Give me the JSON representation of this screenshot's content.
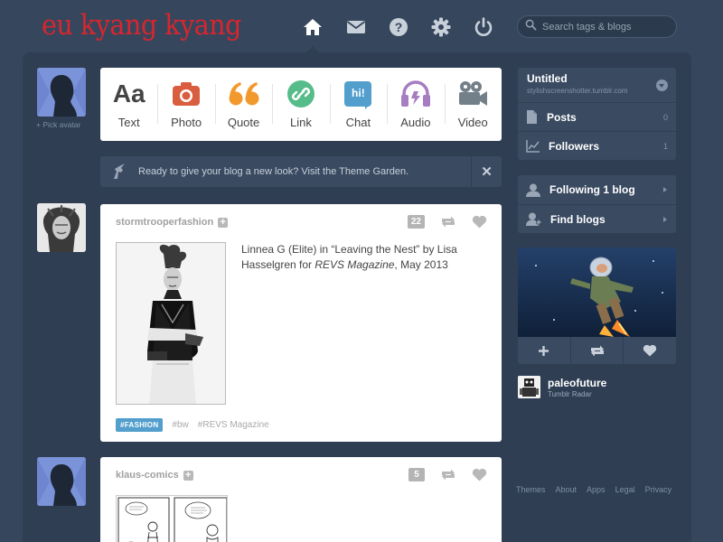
{
  "header": {
    "logo_text": "eu kyang kyang",
    "nav": [
      {
        "name": "home",
        "icon": "home-icon"
      },
      {
        "name": "messages",
        "icon": "envelope-icon"
      },
      {
        "name": "help",
        "icon": "question-icon"
      },
      {
        "name": "settings",
        "icon": "gear-icon"
      },
      {
        "name": "logout",
        "icon": "power-icon"
      }
    ],
    "search": {
      "placeholder": "Search tags & blogs",
      "value": ""
    }
  },
  "avatar": {
    "pick_label": "+ Pick avatar"
  },
  "post_types": [
    {
      "label": "Text",
      "icon": "text-icon",
      "glyph": "Aa",
      "color": "#444444"
    },
    {
      "label": "Photo",
      "icon": "camera-icon",
      "color": "#d95e40"
    },
    {
      "label": "Quote",
      "icon": "quote-icon",
      "color": "#f2992e"
    },
    {
      "label": "Link",
      "icon": "link-icon",
      "color": "#56bc8a"
    },
    {
      "label": "Chat",
      "icon": "chat-icon",
      "glyph": "hi!",
      "color": "#529ecc"
    },
    {
      "label": "Audio",
      "icon": "headphones-icon",
      "color": "#a77dc2"
    },
    {
      "label": "Video",
      "icon": "video-camera-icon",
      "color": "#748089"
    }
  ],
  "theme_banner": {
    "text": "Ready to give your blog a new look? Visit the Theme Garden.",
    "close": "✕"
  },
  "posts": [
    {
      "user": "stormtrooperfashion",
      "notes": "22",
      "caption_before": "Linnea G (Elite) in “Leaving the Nest” by Lisa Hasselgren for ",
      "caption_em": "REVS Magazine",
      "caption_after": ", May 2013",
      "featured_tag": "#FASHION",
      "tags": [
        "#bw",
        "#REVS Magazine"
      ]
    },
    {
      "user": "klaus-comics",
      "notes": "5"
    }
  ],
  "sidebar": {
    "blog": {
      "title": "Untitled",
      "url": "stylishscreenshotter.tumblr.com"
    },
    "blog_items": [
      {
        "label": "Posts",
        "count": "0",
        "icon": "document-icon"
      },
      {
        "label": "Followers",
        "count": "1",
        "icon": "chart-icon"
      }
    ],
    "following": [
      {
        "label": "Following 1 blog",
        "icon": "person-icon"
      },
      {
        "label": "Find blogs",
        "icon": "add-person-icon"
      }
    ]
  },
  "radar": {
    "user": "paleofuture",
    "subtitle": "Tumblr Radar"
  },
  "footer": [
    "Themes",
    "About",
    "Apps",
    "Legal",
    "Privacy"
  ],
  "colors": {
    "background": "#36465d",
    "panel": "#2f3e53",
    "card": "#ffffff",
    "accent": "#529ecc",
    "logo": "#d8262e"
  }
}
